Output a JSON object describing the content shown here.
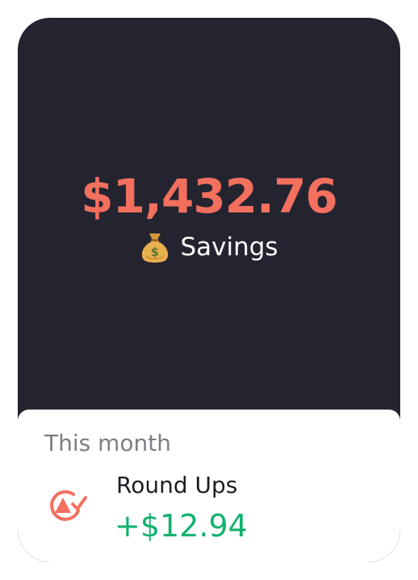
{
  "balance": {
    "amount": "$1,432.76",
    "account_icon": "money-bag-icon",
    "account_label": "Savings"
  },
  "summary": {
    "period_label": "This month",
    "item": {
      "icon": "round-ups-icon",
      "title": "Round Ups",
      "value": "+$12.94"
    }
  },
  "colors": {
    "card_background": "#242430",
    "amount": "#f36f5e",
    "positive": "#12b26f",
    "muted": "#7d7d84"
  }
}
